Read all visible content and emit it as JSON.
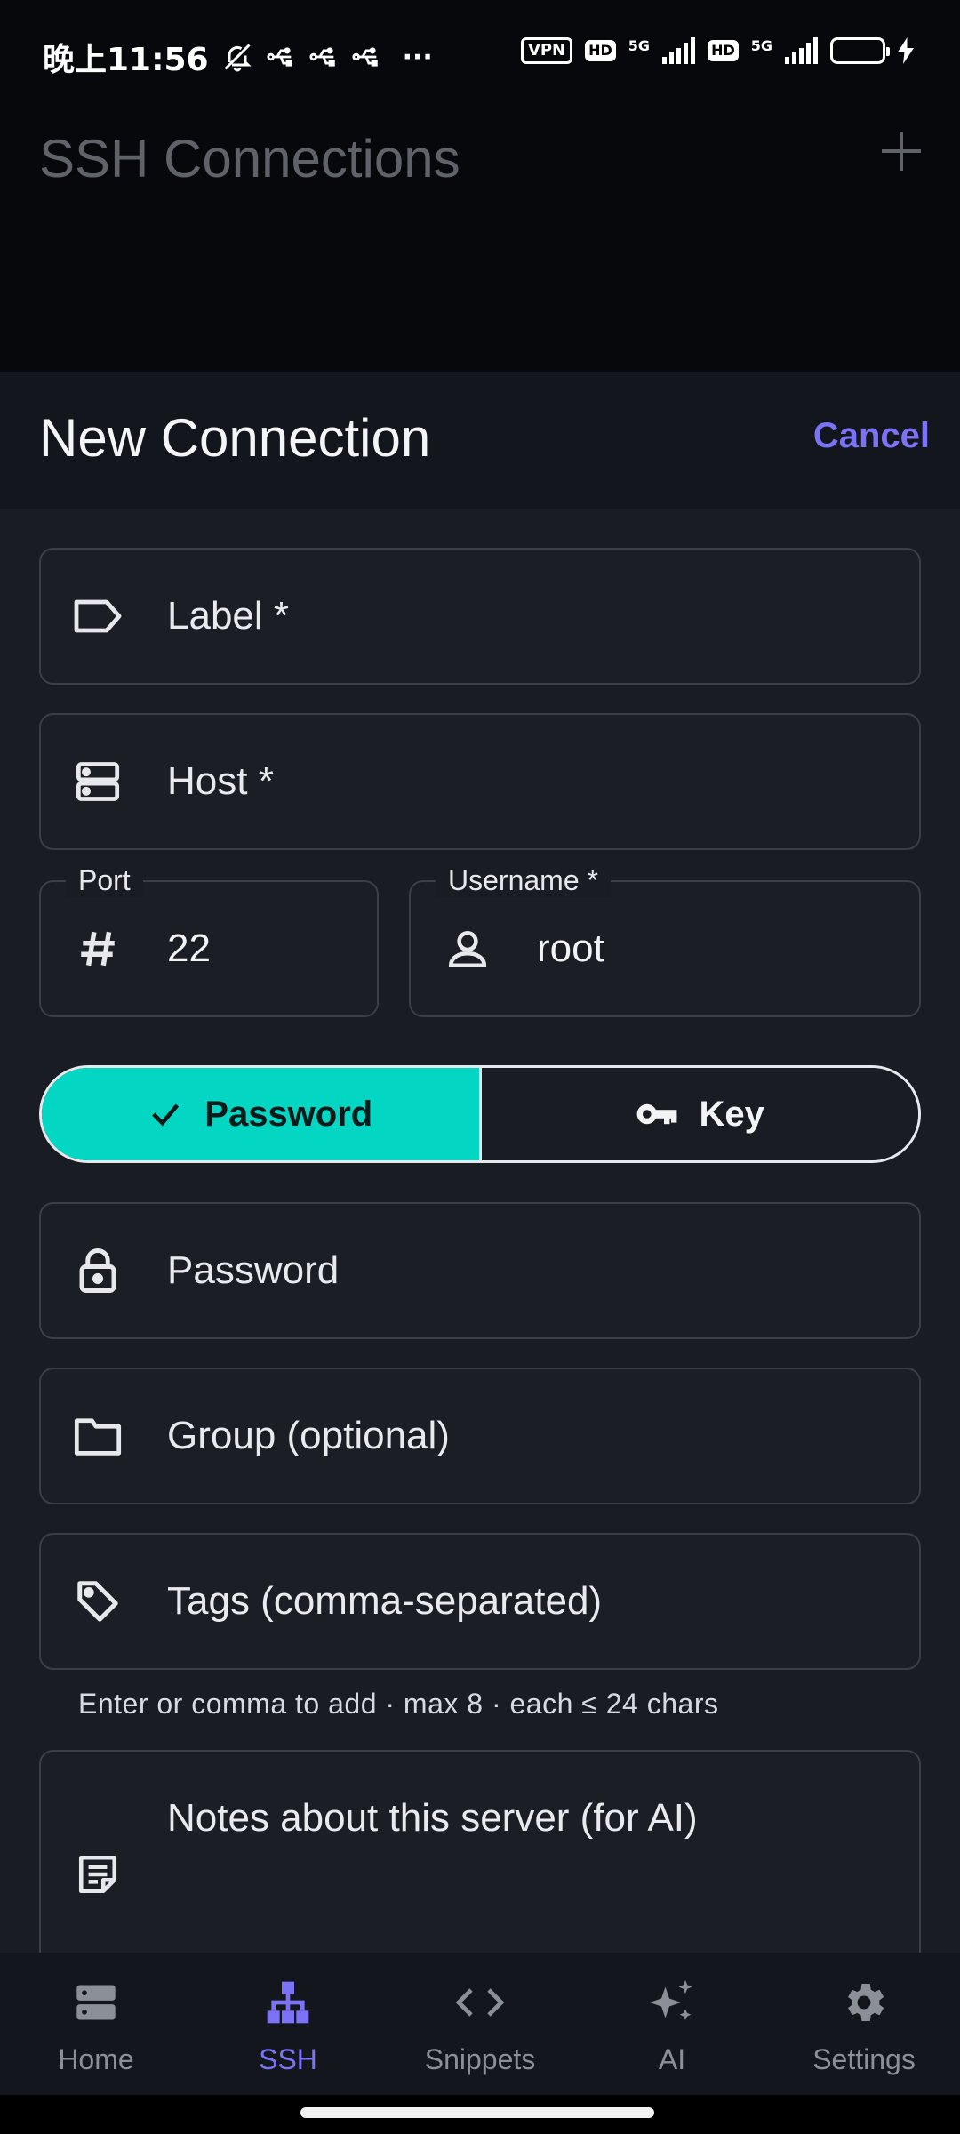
{
  "status_bar": {
    "time": "晚上11:56",
    "more": "···",
    "vpn": "VPN",
    "hd1": "HD",
    "net1": "5G",
    "hd2": "HD",
    "net2": "5G"
  },
  "background_screen": {
    "title": "SSH Connections",
    "add_icon": "plus-icon"
  },
  "sheet": {
    "title": "New Connection",
    "cancel_label": "Cancel"
  },
  "form": {
    "label_field": {
      "placeholder": "Label *",
      "icon": "label-tag-icon"
    },
    "host_field": {
      "placeholder": "Host *",
      "icon": "server-icon"
    },
    "port_field": {
      "label": "Port",
      "value": "22",
      "icon": "hash-icon"
    },
    "username_field": {
      "label": "Username *",
      "value": "root",
      "icon": "person-icon"
    },
    "auth_toggle": {
      "options": [
        {
          "label": "Password",
          "icon": "check-icon",
          "selected": true
        },
        {
          "label": "Key",
          "icon": "key-icon",
          "selected": false
        }
      ],
      "selected_color": "#04d6c4"
    },
    "password_field": {
      "placeholder": "Password",
      "icon": "lock-icon"
    },
    "group_field": {
      "placeholder": "Group (optional)",
      "icon": "folder-icon"
    },
    "tags_field": {
      "placeholder": "Tags (comma-separated)",
      "icon": "tag-icon"
    },
    "tags_helper": "Enter or comma to add · max 8 · each ≤ 24 chars",
    "notes_field": {
      "placeholder": "Notes about this server (for AI)",
      "icon": "note-icon"
    }
  },
  "bottom_nav": {
    "items": [
      {
        "label": "Home",
        "icon": "server-stack-icon",
        "active": false
      },
      {
        "label": "SSH",
        "icon": "hierarchy-icon",
        "active": true
      },
      {
        "label": "Snippets",
        "icon": "code-icon",
        "active": false
      },
      {
        "label": "AI",
        "icon": "sparkles-icon",
        "active": false
      },
      {
        "label": "Settings",
        "icon": "gear-icon",
        "active": false
      }
    ],
    "active_color": "#7b72f5",
    "inactive_color": "#8b8f97"
  }
}
